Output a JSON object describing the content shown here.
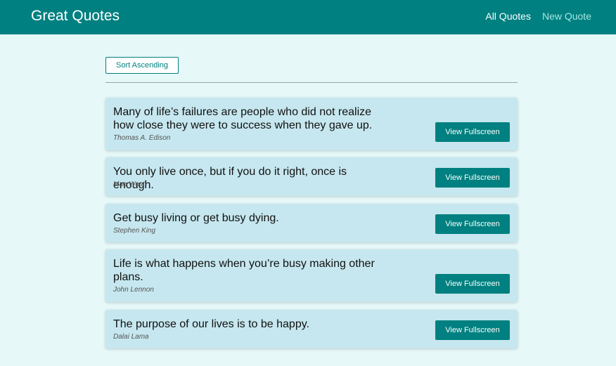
{
  "header": {
    "title": "Great Quotes",
    "nav": [
      {
        "label": "All Quotes",
        "active": true
      },
      {
        "label": "New Quote",
        "active": false
      }
    ]
  },
  "controls": {
    "sort_label": "Sort Ascending"
  },
  "quotes": [
    {
      "text": "Many of life’s failures are people who did not realize how close they were to success when they gave up.",
      "author": "Thomas A. Edison",
      "button": "View Fullscreen"
    },
    {
      "text": "You only live once, but if you do it right, once is enough.",
      "author": "Mae West",
      "button": "View Fullscreen"
    },
    {
      "text": "Get busy living or get busy dying.",
      "author": "Stephen King",
      "button": "View Fullscreen"
    },
    {
      "text": "Life is what happens when you’re busy making other plans.",
      "author": "John Lennon",
      "button": "View Fullscreen"
    },
    {
      "text": "The purpose of our lives is to be happy.",
      "author": "Dalai Lama",
      "button": "View Fullscreen"
    }
  ],
  "colors": {
    "primary": "#008080",
    "background": "#e6f8f8",
    "card": "#c6e7ef"
  }
}
